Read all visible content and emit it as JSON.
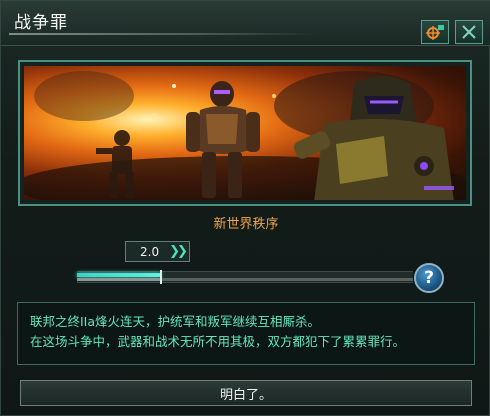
{
  "dialog": {
    "title": "战争罪",
    "icons": {
      "target": "target-camera-icon",
      "close": "close-icon"
    }
  },
  "scene": {
    "caption": "新世界秩序"
  },
  "playback": {
    "speed_label": "2.0",
    "speed_icon": "fast-forward-icon",
    "progress": 0.25,
    "help_label": "?"
  },
  "description": {
    "lines": [
      "联邦之终IIa烽火连天，护统军和叛军继续互相厮杀。",
      "在这场斗争中，武器和战术无所不用其极，双方都犯下了累累罪行。"
    ]
  },
  "confirm": {
    "label": "明白了。"
  },
  "colors": {
    "accent": "#4ce3c0",
    "caption": "#f0a24a",
    "text_green": "#63e7bf"
  }
}
